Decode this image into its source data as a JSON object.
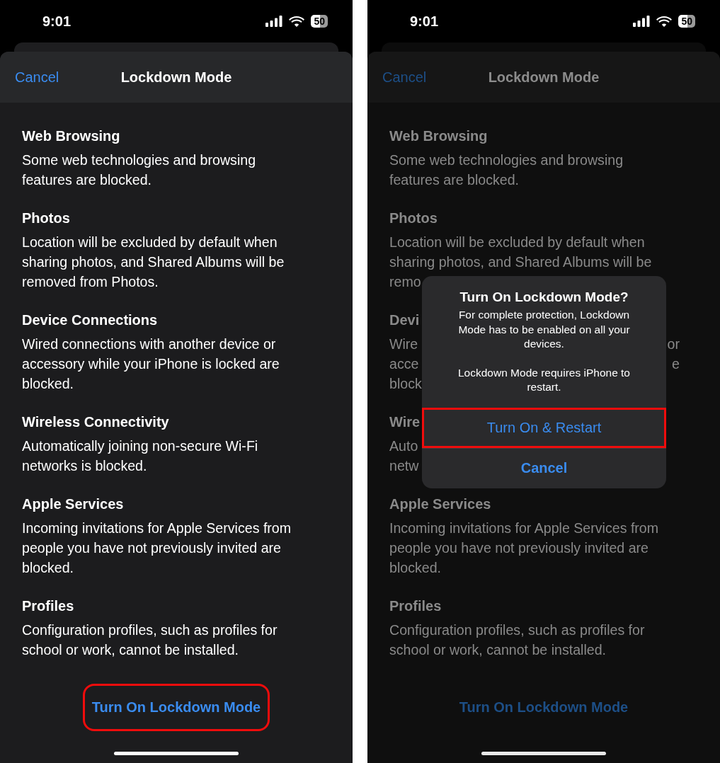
{
  "screens": [
    {
      "dimmed": false,
      "status_bar": {
        "time": "9:01",
        "battery": "50"
      },
      "nav": {
        "cancel": "Cancel",
        "title": "Lockdown Mode"
      },
      "sections": [
        {
          "title": [
            "Web Browsing"
          ],
          "lines": [
            [
              "Some web technologies and browsing"
            ],
            [
              "features are blocked."
            ]
          ]
        },
        {
          "title": [
            "Photos"
          ],
          "lines": [
            [
              "Location will be excluded by default when"
            ],
            [
              "sharing photos, and Shared Albums will be"
            ],
            [
              "removed from Photos."
            ]
          ]
        },
        {
          "title": [
            "Device Connections"
          ],
          "lines": [
            [
              "Wired connections with another device or"
            ],
            [
              "accessory while your iPhone is locked are"
            ],
            [
              "blocked."
            ]
          ]
        },
        {
          "title": [
            "Wireless Connectivity"
          ],
          "lines": [
            [
              "Automatically joining non-secure Wi-Fi"
            ],
            [
              "networks is blocked."
            ]
          ]
        },
        {
          "title": [
            "Apple Services"
          ],
          "lines": [
            [
              "Incoming invitations for Apple Services from"
            ],
            [
              "people you have not previously invited are"
            ],
            [
              "blocked."
            ]
          ]
        },
        {
          "title": [
            "Profiles"
          ],
          "lines": [
            [
              "Configuration profiles, such as profiles for"
            ],
            [
              "school or work, cannot be installed."
            ]
          ]
        }
      ],
      "action": {
        "label": "Turn On Lockdown Mode",
        "highlighted": true
      }
    },
    {
      "dimmed": true,
      "status_bar": {
        "time": "9:01",
        "battery": "50"
      },
      "nav": {
        "cancel": "Cancel",
        "title": "Lockdown Mode"
      },
      "sections": [
        {
          "title": [
            "Web Browsing"
          ],
          "lines": [
            [
              "Some web technologies and browsing"
            ],
            [
              "features are blocked."
            ]
          ]
        },
        {
          "title": [
            "Photos"
          ],
          "lines": [
            [
              "Location will be excluded by default when"
            ],
            [
              "sharing photos, and Shared Albums will be"
            ],
            [
              "remo"
            ]
          ]
        },
        {
          "title": [
            "Devi"
          ],
          "lines": [
            [
              "Wire",
              "or"
            ],
            [
              "acce",
              "e"
            ],
            [
              "block"
            ]
          ]
        },
        {
          "title": [
            "Wire"
          ],
          "lines": [
            [
              "Auto"
            ],
            [
              "netw"
            ]
          ]
        },
        {
          "title": [
            "Apple Services"
          ],
          "lines": [
            [
              "Incoming invitations for Apple Services from"
            ],
            [
              "people you have not previously invited are"
            ],
            [
              "blocked."
            ]
          ]
        },
        {
          "title": [
            "Profiles"
          ],
          "lines": [
            [
              "Configuration profiles, such as profiles for"
            ],
            [
              "school or work, cannot be installed."
            ]
          ]
        }
      ],
      "action": {
        "label": "Turn On Lockdown Mode",
        "highlighted": false
      },
      "alert": {
        "title": "Turn On Lockdown Mode?",
        "message": [
          "For complete protection, Lockdown Mode has to be enabled on all your devices.",
          "Lockdown Mode requires iPhone to restart."
        ],
        "actions": [
          {
            "label": "Turn On & Restart",
            "kind": "default",
            "highlighted": true
          },
          {
            "label": "Cancel",
            "kind": "cancel",
            "highlighted": false
          }
        ]
      }
    }
  ]
}
